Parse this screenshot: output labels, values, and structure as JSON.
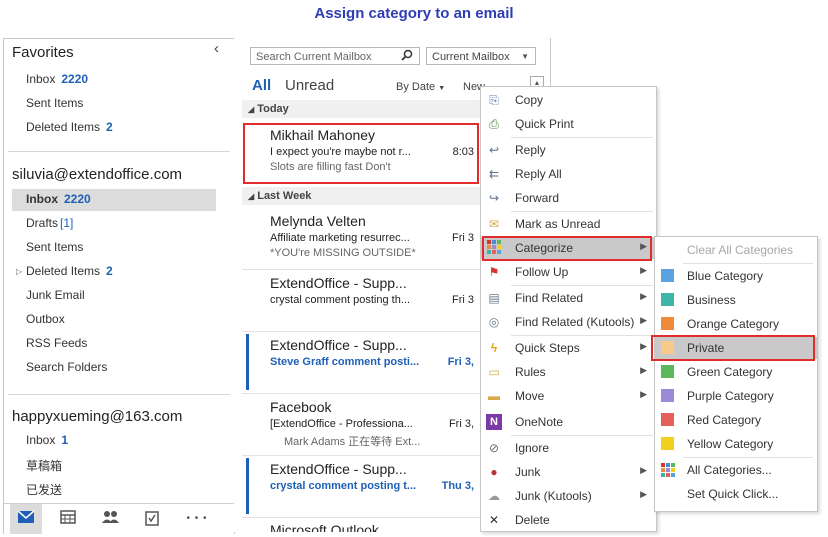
{
  "title": "Assign category to an email",
  "left": {
    "favorites_label": "Favorites",
    "collapse_glyph": "‹",
    "favorites": [
      {
        "label": "Inbox",
        "count": "2220"
      },
      {
        "label": "Sent Items",
        "count": ""
      },
      {
        "label": "Deleted Items",
        "count": "2"
      }
    ],
    "account1": "siluvia@extendoffice.com",
    "folders1": [
      {
        "label": "Inbox",
        "count": "2220"
      },
      {
        "label": "Drafts",
        "count": "[1]"
      },
      {
        "label": "Sent Items",
        "count": ""
      },
      {
        "label": "Deleted Items",
        "count": "2"
      },
      {
        "label": "Junk Email",
        "count": ""
      },
      {
        "label": "Outbox",
        "count": ""
      },
      {
        "label": "RSS Feeds",
        "count": ""
      },
      {
        "label": "Search Folders",
        "count": ""
      }
    ],
    "account2": "happyxueming@163.com",
    "folders2": [
      {
        "label": "Inbox",
        "count": "1"
      },
      {
        "label": "草稿箱",
        "count": ""
      },
      {
        "label": "已发送",
        "count": ""
      }
    ],
    "bottom_icons": [
      "mail-icon",
      "calendar-icon",
      "people-icon",
      "tasks-icon",
      "more-icon"
    ],
    "more_glyph": "• • •"
  },
  "list": {
    "search_placeholder": "Search Current Mailbox",
    "scope": "Current Mailbox",
    "tab_all": "All",
    "tab_unread": "Unread",
    "sort_by": "By Date",
    "sort_order": "New",
    "group_today": "Today",
    "group_lastweek": "Last Week",
    "mails": [
      {
        "from": "Mikhail Mahoney",
        "subject": "I expect you're maybe not r...",
        "preview": "Slots are filling fast  Don't",
        "time": "8:03"
      },
      {
        "from": "Melynda Velten",
        "subject": "Affiliate marketing resurrec...",
        "preview": "*YOU're MISSING OUTSIDE*",
        "time": "Fri 3"
      },
      {
        "from": "ExtendOffice - Supp...",
        "subject": "crystal comment posting th...",
        "preview": "",
        "time": "Fri 3"
      },
      {
        "from": "ExtendOffice - Supp...",
        "subject": "Steve Graff comment posti...",
        "preview": "",
        "time": "Fri 3,"
      },
      {
        "from": "Facebook",
        "subject": "[ExtendOffice - Professiona...",
        "preview": "Mark Adams 正在等待 Ext...",
        "time": "Fri 3,"
      },
      {
        "from": "ExtendOffice - Supp...",
        "subject": "crystal comment posting t...",
        "preview": "",
        "time": "Thu 3,"
      },
      {
        "from": "Microsoft Outlook",
        "subject": "",
        "preview": "",
        "time": ""
      }
    ]
  },
  "context_menu": [
    {
      "label": "Copy",
      "icon": "copy-icon",
      "glyph": "⎘",
      "color": "#5b7ea8"
    },
    {
      "label": "Quick Print",
      "icon": "quick-print-icon",
      "glyph": "⎙",
      "color": "#4a8a3e"
    },
    {
      "label": "Reply",
      "icon": "reply-icon",
      "glyph": "↩",
      "color": "#5b6f8a"
    },
    {
      "label": "Reply All",
      "icon": "reply-all-icon",
      "glyph": "⇇",
      "color": "#5b6f8a"
    },
    {
      "label": "Forward",
      "icon": "forward-icon",
      "glyph": "↪",
      "color": "#5b6f8a"
    },
    {
      "label": "Mark as Unread",
      "icon": "envelope-icon",
      "glyph": "✉",
      "color": "#d9a94a"
    },
    {
      "label": "Categorize",
      "icon": "categorize-icon",
      "glyph": "■",
      "color": "#d46b2a"
    },
    {
      "label": "Follow Up",
      "icon": "flag-icon",
      "glyph": "⚑",
      "color": "#d9342b"
    },
    {
      "label": "Find Related",
      "icon": "find-related-icon",
      "glyph": "▤",
      "color": "#6a7a92"
    },
    {
      "label": "Find Related (Kutools)",
      "icon": "kutools-search-icon",
      "glyph": "◎",
      "color": "#6a7a92"
    },
    {
      "label": "Quick Steps",
      "icon": "lightning-icon",
      "glyph": "ϟ",
      "color": "#e0a020"
    },
    {
      "label": "Rules",
      "icon": "rules-icon",
      "glyph": "▭",
      "color": "#d9a94a"
    },
    {
      "label": "Move",
      "icon": "move-icon",
      "glyph": "▬",
      "color": "#d9a94a"
    },
    {
      "label": "OneNote",
      "icon": "onenote-icon",
      "glyph": "N",
      "color": "#7b3aa6"
    },
    {
      "label": "Ignore",
      "icon": "ignore-icon",
      "glyph": "⊘",
      "color": "#6a6a6a"
    },
    {
      "label": "Junk",
      "icon": "junk-icon",
      "glyph": "●",
      "color": "#b33"
    },
    {
      "label": "Junk (Kutools)",
      "icon": "junk-kutools-icon",
      "glyph": "☁",
      "color": "#888"
    },
    {
      "label": "Delete",
      "icon": "delete-icon",
      "glyph": "✕",
      "color": "#333"
    }
  ],
  "categories_menu": [
    {
      "label": "Clear All Categories",
      "color": ""
    },
    {
      "label": "Blue Category",
      "color": "#5aa2e0"
    },
    {
      "label": "Business",
      "color": "#3fb5a8"
    },
    {
      "label": "Orange Category",
      "color": "#ee8a3a"
    },
    {
      "label": "Private",
      "color": "#f9c98a"
    },
    {
      "label": "Green Category",
      "color": "#5cb85c"
    },
    {
      "label": "Purple Category",
      "color": "#9b8ad6"
    },
    {
      "label": "Red Category",
      "color": "#e5605a"
    },
    {
      "label": "Yellow Category",
      "color": "#f3d020"
    },
    {
      "label": "All Categories...",
      "color": ""
    },
    {
      "label": "Set Quick Click...",
      "color": ""
    }
  ]
}
